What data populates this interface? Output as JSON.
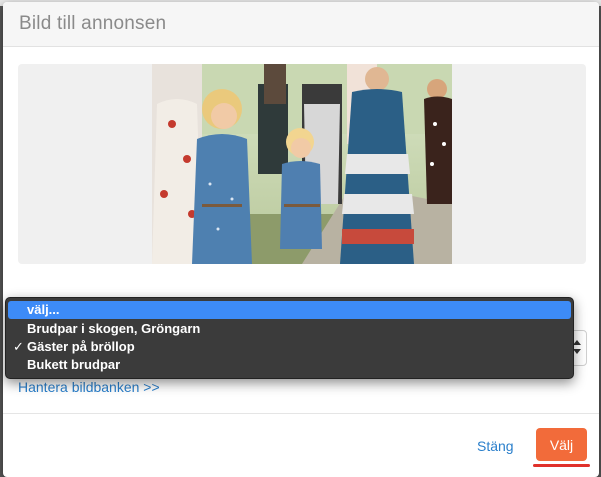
{
  "dialog": {
    "title": "Bild till annonsen"
  },
  "dropdown": {
    "options": [
      {
        "label": "välj...",
        "highlighted": true,
        "checked": false
      },
      {
        "label": "Brudpar i skogen, Gröngarn",
        "highlighted": false,
        "checked": false
      },
      {
        "label": "Gäster på bröllop",
        "highlighted": false,
        "checked": true
      },
      {
        "label": "Bukett brudpar",
        "highlighted": false,
        "checked": false
      }
    ],
    "checkmark": "✓"
  },
  "links": {
    "manage": "Hantera bildbanken >>"
  },
  "footer": {
    "close_label": "Stäng",
    "choose_label": "Välj"
  },
  "colors": {
    "accent_button": "#f26b3a",
    "link": "#2a7fcb",
    "dropdown_highlight": "#3d8bf7",
    "underline_marker": "#e0312b"
  }
}
